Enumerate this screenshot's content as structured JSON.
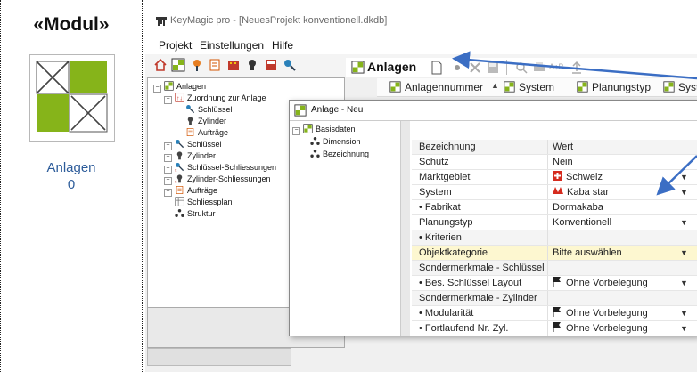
{
  "module": {
    "title": "«Modul»",
    "label": "Anlagen",
    "count": "0",
    "green": "#86b41a"
  },
  "window": {
    "title": "KeyMagic pro - [NeuesProjekt konventionell.dkdb]"
  },
  "menu": [
    "Projekt",
    "Einstellungen",
    "Hilfe"
  ],
  "tree": [
    {
      "label": "Anlagen",
      "level": 0,
      "icon": "anlagen-icon",
      "exp": "−"
    },
    {
      "label": "Zuordnung zur Anlage",
      "level": 1,
      "icon": "sort-icon",
      "exp": "−"
    },
    {
      "label": "Schlüssel",
      "level": 2,
      "icon": "key-icon",
      "exp": ""
    },
    {
      "label": "Zylinder",
      "level": 2,
      "icon": "cylinder-icon",
      "exp": ""
    },
    {
      "label": "Aufträge",
      "level": 2,
      "icon": "orders-icon",
      "exp": ""
    },
    {
      "label": "Schlüssel",
      "level": 1,
      "icon": "key-icon",
      "exp": "+"
    },
    {
      "label": "Zylinder",
      "level": 1,
      "icon": "cylinder-icon",
      "exp": "+"
    },
    {
      "label": "Schlüssel-Schliessungen",
      "level": 1,
      "icon": "key-lock-icon",
      "exp": "+"
    },
    {
      "label": "Zylinder-Schliessungen",
      "level": 1,
      "icon": "cylinder-lock-icon",
      "exp": "+"
    },
    {
      "label": "Aufträge",
      "level": 1,
      "icon": "orders-icon",
      "exp": "+"
    },
    {
      "label": "Schliessplan",
      "level": 1,
      "icon": "plan-icon",
      "exp": ""
    },
    {
      "label": "Struktur",
      "level": 1,
      "icon": "structure-icon",
      "exp": ""
    }
  ],
  "right_panel": {
    "title": "Anlagen",
    "columns": [
      "Anlagennummer",
      "System",
      "Planungstyp",
      "System"
    ]
  },
  "dialog": {
    "title": "Anlage - Neu",
    "tree": [
      {
        "label": "Basisdaten",
        "level": 0
      },
      {
        "label": "Dimension",
        "level": 1
      },
      {
        "label": "Bezeichnung",
        "level": 1
      }
    ],
    "header": {
      "col1": "Bezeichnung",
      "col2": "Wert"
    },
    "rows": [
      {
        "label": "Schutz",
        "value": "Nein",
        "icon": "",
        "dropdown": false,
        "type": "normal"
      },
      {
        "label": "Marktgebiet",
        "value": "Schweiz",
        "icon": "swiss-flag-icon",
        "dropdown": true,
        "type": "normal"
      },
      {
        "label": "System",
        "value": "Kaba star",
        "icon": "kaba-logo-icon",
        "dropdown": true,
        "type": "normal"
      },
      {
        "label": "• Fabrikat",
        "value": "Dormakaba",
        "icon": "",
        "dropdown": false,
        "type": "normal"
      },
      {
        "label": "Planungstyp",
        "value": "Konventionell",
        "icon": "",
        "dropdown": true,
        "type": "normal"
      },
      {
        "label": "• Kriterien",
        "value": "",
        "icon": "",
        "dropdown": false,
        "type": "section"
      },
      {
        "label": "Objektkategorie",
        "value": "Bitte auswählen",
        "icon": "",
        "dropdown": true,
        "type": "highlight"
      },
      {
        "label": "Sondermerkmale - Schlüssel",
        "value": "",
        "icon": "",
        "dropdown": false,
        "type": "section"
      },
      {
        "label": "• Bes. Schlüssel Layout",
        "value": "Ohne Vorbelegung",
        "icon": "flag-icon",
        "dropdown": true,
        "type": "normal"
      },
      {
        "label": "Sondermerkmale - Zylinder",
        "value": "",
        "icon": "",
        "dropdown": false,
        "type": "section"
      },
      {
        "label": "• Modularität",
        "value": "Ohne Vorbelegung",
        "icon": "flag-icon",
        "dropdown": true,
        "type": "normal"
      },
      {
        "label": "• Fortlaufend Nr. Zyl.",
        "value": "Ohne Vorbelegung",
        "icon": "flag-icon",
        "dropdown": true,
        "type": "normal"
      }
    ]
  },
  "colors": {
    "accent_blue": "#3b6ec4",
    "module_text": "#2d5c9a",
    "highlight": "#fdf7d0",
    "swiss_red": "#d52b1e"
  }
}
